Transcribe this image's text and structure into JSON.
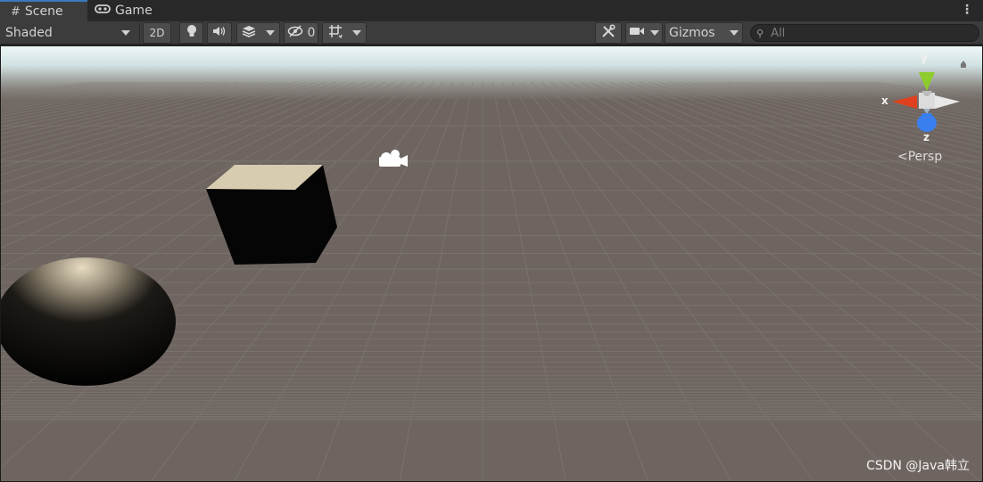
{
  "tabs": [
    {
      "label": "Scene",
      "icon": "hash-grid-icon",
      "active": true
    },
    {
      "label": "Game",
      "icon": "gamepad-icon",
      "active": false
    }
  ],
  "toolbar": {
    "draw_mode": "Shaded",
    "mode_2d": "2D",
    "hidden_count": "0",
    "gizmos_label": "Gizmos",
    "search_placeholder": "All"
  },
  "scene": {
    "axes": {
      "x": "x",
      "y": "y",
      "z": "z"
    },
    "projection": "Persp",
    "colors": {
      "sky": "#e6f3f6",
      "ground": "#6e6560",
      "x_axis": "#e0401e",
      "y_axis": "#8dcc2c",
      "z_axis": "#3a7ff0",
      "accent_tab": "#3a79bb"
    }
  },
  "watermark": "CSDN @Java韩立"
}
